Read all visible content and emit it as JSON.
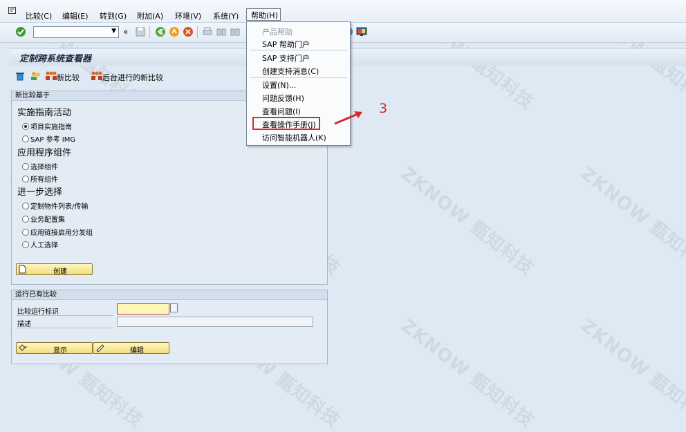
{
  "menubar": {
    "items": [
      "比较(C)",
      "编辑(E)",
      "转到(G)",
      "附加(A)",
      "环境(V)",
      "系统(Y)",
      "帮助(H)"
    ]
  },
  "title": "定制跨系统查看器",
  "app_toolbar": {
    "new_compare": "新比较",
    "bg_compare": "后台进行的新比较"
  },
  "group_new": {
    "title": "新比较基于",
    "section1": "实施指南活动",
    "radio1": "项目实施指南",
    "radio2": "SAP 参考 IMG",
    "section2": "应用程序组件",
    "radio3": "选择组件",
    "radio4": "所有组件",
    "section3": "进一步选择",
    "radio5": "定制物件列表/传输",
    "radio6": "业务配置集",
    "radio7": "应用链接启用分发组",
    "radio8": "人工选择",
    "create": "创建"
  },
  "group_existing": {
    "title": "运行已有比较",
    "label_id": "比较运行标识",
    "label_desc": "描述",
    "display": "显示",
    "edit": "编辑"
  },
  "help_menu": {
    "items": [
      "产品帮助",
      "SAP 帮助门户",
      "SAP 支持门户",
      "创建支持消息(C)",
      "设置(N)...",
      "问题反馈(H)",
      "查看问题(I)",
      "查看操作手册(J)",
      "访问智能机器人(K)"
    ]
  },
  "annotation": "3",
  "watermark": "ZKNOW 甄知科技",
  "colors": {
    "highlight": "#e0262b",
    "button": "#f3dd7b"
  }
}
